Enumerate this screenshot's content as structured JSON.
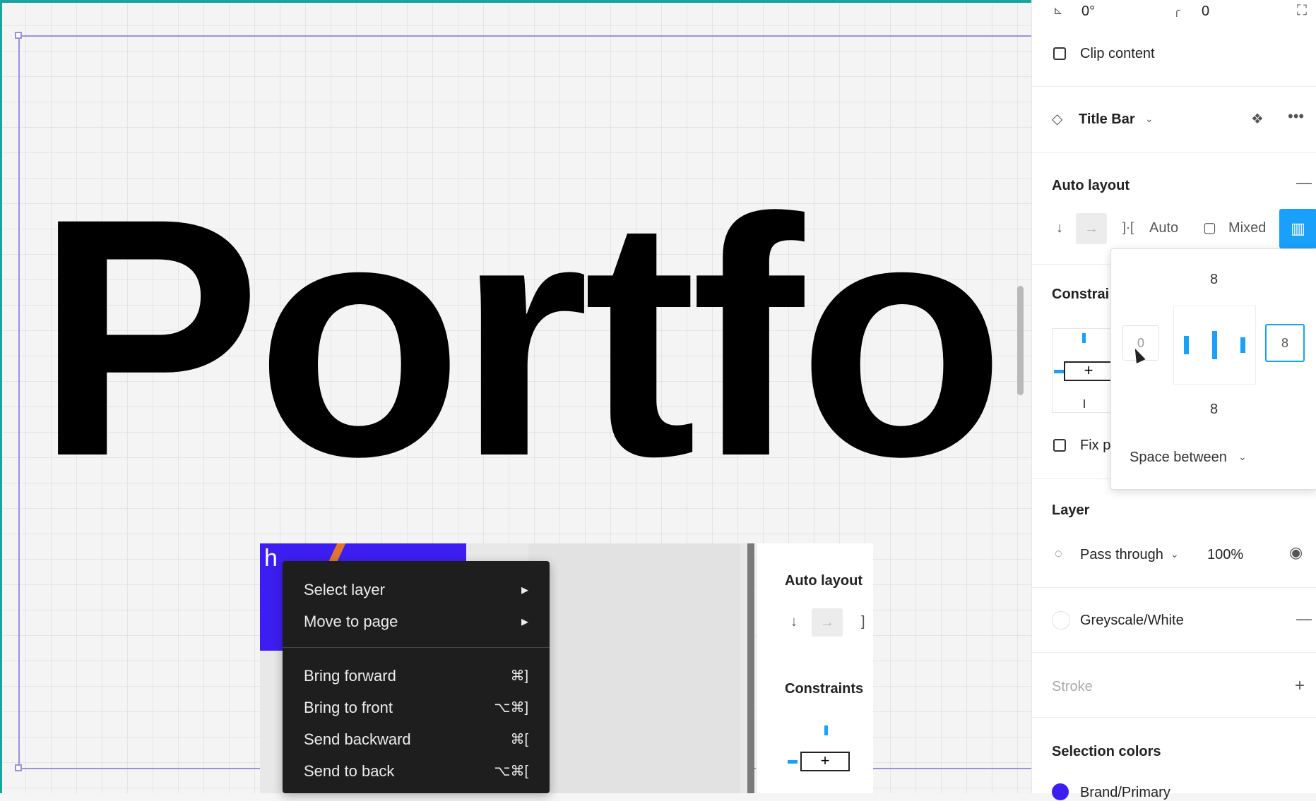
{
  "canvas": {
    "big_text": "Portfo",
    "inset_header_letter": "h"
  },
  "panel": {
    "rotation_value": "0°",
    "corner_radius_value": "0",
    "clip_content_label": "Clip content",
    "component_name": "Title Bar",
    "auto_layout_title": "Auto layout",
    "spacing_mode": "Auto",
    "padding_mode": "Mixed",
    "constraints_title": "Constrai",
    "fix_position_label": "Fix p",
    "layer_title": "Layer",
    "blend_mode": "Pass through",
    "opacity": "100%",
    "fill_name": "Greyscale/White",
    "stroke_title": "Stroke",
    "selection_colors_title": "Selection colors",
    "selection_color_name": "Brand/Primary"
  },
  "popover": {
    "top_padding": "8",
    "left_padding": "0",
    "right_padding": "8",
    "bottom_padding": "8",
    "distribution": "Space between"
  },
  "context_menu": {
    "items": [
      {
        "label": "Select layer",
        "shortcut": "▸"
      },
      {
        "label": "Move to page",
        "shortcut": "▸"
      },
      {
        "label": "Bring forward",
        "shortcut": "⌘]"
      },
      {
        "label": "Bring to front",
        "shortcut": "⌥⌘]"
      },
      {
        "label": "Send backward",
        "shortcut": "⌘["
      },
      {
        "label": "Send to back",
        "shortcut": "⌥⌘["
      }
    ]
  },
  "inset_panel": {
    "auto_layout_title": "Auto layout",
    "constraints_title": "Constraints"
  },
  "colors": {
    "accent_blue": "#18a0fb",
    "frame_purple": "#9d8fe0",
    "brand_primary": "#3d1ef0",
    "menu_bg": "#1e1e1e",
    "border_teal": "#1aa3a0"
  }
}
